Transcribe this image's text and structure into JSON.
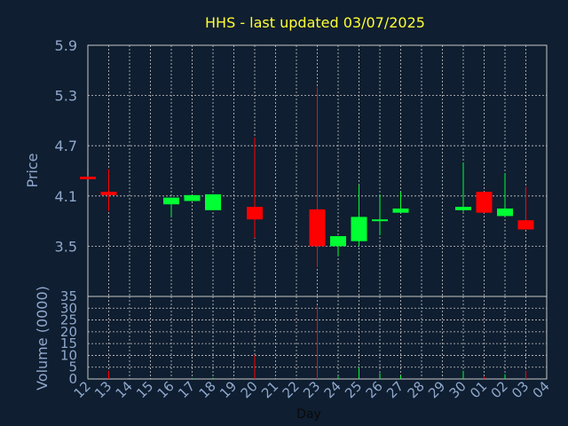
{
  "title": "HHS - last updated 03/07/2025",
  "colors": {
    "background": "#0f1e30",
    "title": "#ffff33",
    "axis_text": "#8fa8cc",
    "grid": "#c8c8c8",
    "up": "#00ff33",
    "down": "#ff0000"
  },
  "chart_data": [
    {
      "type": "candlestick",
      "ylabel": "Price",
      "ylim": [
        2.9,
        5.9
      ],
      "yticks": [
        "5.9",
        "5.3",
        "4.7",
        "4.1",
        "3.5"
      ],
      "grid": true,
      "categories": [
        "12",
        "13",
        "14",
        "15",
        "16",
        "17",
        "18",
        "19",
        "20",
        "21",
        "22",
        "23",
        "24",
        "25",
        "26",
        "27",
        "28",
        "29",
        "30",
        "01",
        "02",
        "03",
        "04"
      ],
      "candles": [
        {
          "x": "12",
          "open": 4.33,
          "close": 4.3,
          "high": 4.33,
          "low": 4.3
        },
        {
          "x": "13",
          "open": 4.15,
          "close": 4.11,
          "high": 4.42,
          "low": 3.92
        },
        {
          "x": "16",
          "open": 4.0,
          "close": 4.08,
          "high": 4.08,
          "low": 3.85
        },
        {
          "x": "17",
          "open": 4.04,
          "close": 4.11,
          "high": 4.11,
          "low": 4.04
        },
        {
          "x": "18",
          "open": 3.93,
          "close": 4.12,
          "high": 4.12,
          "low": 3.93
        },
        {
          "x": "20",
          "open": 3.97,
          "close": 3.82,
          "high": 4.8,
          "low": 3.6
        },
        {
          "x": "23",
          "open": 3.94,
          "close": 3.5,
          "high": 5.4,
          "low": 3.25
        },
        {
          "x": "24",
          "open": 3.5,
          "close": 3.62,
          "high": 3.62,
          "low": 3.38
        },
        {
          "x": "25",
          "open": 3.56,
          "close": 3.85,
          "high": 4.23,
          "low": 3.5
        },
        {
          "x": "26",
          "open": 3.8,
          "close": 3.82,
          "high": 4.12,
          "low": 3.63
        },
        {
          "x": "27",
          "open": 3.9,
          "close": 3.95,
          "high": 4.15,
          "low": 3.9
        },
        {
          "x": "30",
          "open": 3.93,
          "close": 3.97,
          "high": 4.5,
          "low": 3.91
        },
        {
          "x": "01",
          "open": 4.15,
          "close": 3.9,
          "high": 4.15,
          "low": 3.9
        },
        {
          "x": "02",
          "open": 3.86,
          "close": 3.95,
          "high": 4.37,
          "low": 3.86
        },
        {
          "x": "03",
          "open": 3.81,
          "close": 3.7,
          "high": 4.21,
          "low": 3.7
        }
      ]
    },
    {
      "type": "bar",
      "ylabel": "Volume (0000)",
      "xlabel": "Day",
      "ylim": [
        0,
        35
      ],
      "yticks": [
        "35",
        "30",
        "25",
        "20",
        "15",
        "10",
        "5",
        "0"
      ],
      "grid": true,
      "categories": [
        "12",
        "13",
        "14",
        "15",
        "16",
        "17",
        "18",
        "19",
        "20",
        "21",
        "22",
        "23",
        "24",
        "25",
        "26",
        "27",
        "28",
        "29",
        "30",
        "01",
        "02",
        "03",
        "04"
      ],
      "bars": [
        {
          "x": "12",
          "value": 0.3,
          "dir": "up"
        },
        {
          "x": "13",
          "value": 3.5,
          "dir": "down"
        },
        {
          "x": "16",
          "value": 0.3,
          "dir": "up"
        },
        {
          "x": "17",
          "value": 0.3,
          "dir": "up"
        },
        {
          "x": "18",
          "value": 0.5,
          "dir": "up"
        },
        {
          "x": "20",
          "value": 10,
          "dir": "down"
        },
        {
          "x": "23",
          "value": 31,
          "dir": "down"
        },
        {
          "x": "24",
          "value": 1,
          "dir": "up"
        },
        {
          "x": "25",
          "value": 5,
          "dir": "up"
        },
        {
          "x": "26",
          "value": 2.5,
          "dir": "up"
        },
        {
          "x": "27",
          "value": 1.5,
          "dir": "up"
        },
        {
          "x": "30",
          "value": 3.5,
          "dir": "up"
        },
        {
          "x": "01",
          "value": 1,
          "dir": "down"
        },
        {
          "x": "02",
          "value": 2,
          "dir": "up"
        },
        {
          "x": "03",
          "value": 3.5,
          "dir": "down"
        }
      ]
    }
  ]
}
